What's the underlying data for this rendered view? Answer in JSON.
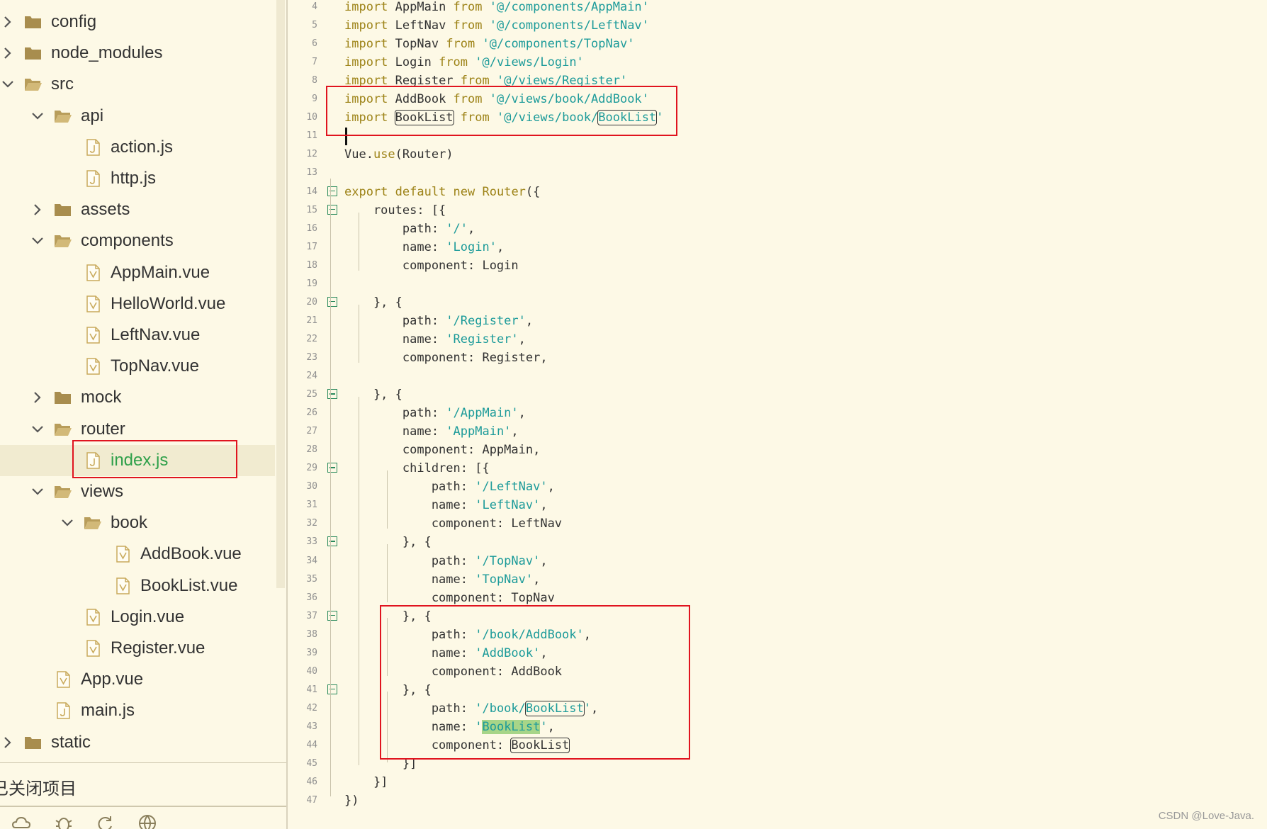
{
  "sidebar": {
    "items": [
      {
        "label": "config",
        "kind": "folder",
        "expanded": false,
        "depth": 0
      },
      {
        "label": "node_modules",
        "kind": "folder",
        "expanded": false,
        "depth": 0
      },
      {
        "label": "src",
        "kind": "folder",
        "expanded": true,
        "depth": 0
      },
      {
        "label": "api",
        "kind": "folder",
        "expanded": true,
        "depth": 1
      },
      {
        "label": "action.js",
        "kind": "js",
        "depth": 2
      },
      {
        "label": "http.js",
        "kind": "js",
        "depth": 2
      },
      {
        "label": "assets",
        "kind": "folder",
        "expanded": false,
        "depth": 1
      },
      {
        "label": "components",
        "kind": "folder",
        "expanded": true,
        "depth": 1
      },
      {
        "label": "AppMain.vue",
        "kind": "vue",
        "depth": 2
      },
      {
        "label": "HelloWorld.vue",
        "kind": "vue",
        "depth": 2
      },
      {
        "label": "LeftNav.vue",
        "kind": "vue",
        "depth": 2
      },
      {
        "label": "TopNav.vue",
        "kind": "vue",
        "depth": 2
      },
      {
        "label": "mock",
        "kind": "folder",
        "expanded": false,
        "depth": 1
      },
      {
        "label": "router",
        "kind": "folder",
        "expanded": true,
        "depth": 1
      },
      {
        "label": "index.js",
        "kind": "js",
        "depth": 2,
        "selected": true
      },
      {
        "label": "views",
        "kind": "folder",
        "expanded": true,
        "depth": 1
      },
      {
        "label": "book",
        "kind": "folder",
        "expanded": true,
        "depth": 2
      },
      {
        "label": "AddBook.vue",
        "kind": "vue",
        "depth": 3
      },
      {
        "label": "BookList.vue",
        "kind": "vue",
        "depth": 3
      },
      {
        "label": "Login.vue",
        "kind": "vue",
        "depth": 2
      },
      {
        "label": "Register.vue",
        "kind": "vue",
        "depth": 2
      },
      {
        "label": "App.vue",
        "kind": "vue",
        "depth": 1
      },
      {
        "label": "main.js",
        "kind": "js",
        "depth": 1
      },
      {
        "label": "static",
        "kind": "folder",
        "expanded": false,
        "depth": 0
      }
    ],
    "closed_projects_label": "已关闭项目",
    "bottom_icons": [
      "cloud-icon",
      "bug-icon",
      "refresh-icon",
      "globe-icon"
    ]
  },
  "editor": {
    "lines": [
      {
        "num": "4",
        "tokens": [
          [
            "import ",
            "kw"
          ],
          [
            "AppMain ",
            ""
          ],
          [
            "from ",
            "kw"
          ],
          [
            "'@/components/AppMain'",
            "str"
          ]
        ]
      },
      {
        "num": "5",
        "tokens": [
          [
            "import ",
            "kw"
          ],
          [
            "LeftNav ",
            ""
          ],
          [
            "from ",
            "kw"
          ],
          [
            "'@/components/LeftNav'",
            "str"
          ]
        ]
      },
      {
        "num": "6",
        "tokens": [
          [
            "import ",
            "kw"
          ],
          [
            "TopNav ",
            ""
          ],
          [
            "from ",
            "kw"
          ],
          [
            "'@/components/TopNav'",
            "str"
          ]
        ]
      },
      {
        "num": "7",
        "tokens": [
          [
            "import ",
            "kw"
          ],
          [
            "Login ",
            ""
          ],
          [
            "from ",
            "kw"
          ],
          [
            "'@/views/Login'",
            "str"
          ]
        ]
      },
      {
        "num": "8",
        "tokens": [
          [
            "import ",
            "kw"
          ],
          [
            "Register ",
            ""
          ],
          [
            "from ",
            "kw"
          ],
          [
            "'@/views/Register'",
            "str"
          ]
        ]
      },
      {
        "num": "9",
        "tokens": [
          [
            "import ",
            "kw"
          ],
          [
            "AddBook ",
            ""
          ],
          [
            "from ",
            "kw"
          ],
          [
            "'@/views/book/AddBook'",
            "str"
          ]
        ]
      },
      {
        "num": "10",
        "tokens": [
          [
            "import ",
            "kw"
          ],
          [
            "BookList",
            "boxed"
          ],
          [
            " ",
            ""
          ],
          [
            "from ",
            "kw"
          ],
          [
            "'@/views/book/",
            "str"
          ],
          [
            "BookList",
            "str boxed"
          ],
          [
            "'",
            "str"
          ]
        ]
      },
      {
        "num": "11",
        "tokens": []
      },
      {
        "num": "12",
        "tokens": [
          [
            "Vue.",
            ""
          ],
          [
            "use",
            "fn"
          ],
          [
            "(Router)",
            ""
          ]
        ]
      },
      {
        "num": "13",
        "tokens": []
      },
      {
        "num": "14",
        "fold": true,
        "tokens": [
          [
            "export ",
            "kw"
          ],
          [
            "default ",
            "kw"
          ],
          [
            "new ",
            "kw"
          ],
          [
            "Router",
            "fn"
          ],
          [
            "({",
            ""
          ]
        ]
      },
      {
        "num": "15",
        "fold": true,
        "tokens": [
          [
            "    routes: [{",
            ""
          ]
        ]
      },
      {
        "num": "16",
        "tokens": [
          [
            "        path: ",
            ""
          ],
          [
            "'/'",
            "str"
          ],
          [
            ",",
            ""
          ]
        ]
      },
      {
        "num": "17",
        "tokens": [
          [
            "        name: ",
            ""
          ],
          [
            "'Login'",
            "str"
          ],
          [
            ",",
            ""
          ]
        ]
      },
      {
        "num": "18",
        "tokens": [
          [
            "        component: Login",
            ""
          ]
        ]
      },
      {
        "num": "19",
        "tokens": []
      },
      {
        "num": "20",
        "fold": true,
        "tokens": [
          [
            "    }, {",
            ""
          ]
        ]
      },
      {
        "num": "21",
        "tokens": [
          [
            "        path: ",
            ""
          ],
          [
            "'/Register'",
            "str"
          ],
          [
            ",",
            ""
          ]
        ]
      },
      {
        "num": "22",
        "tokens": [
          [
            "        name: ",
            ""
          ],
          [
            "'Register'",
            "str"
          ],
          [
            ",",
            ""
          ]
        ]
      },
      {
        "num": "23",
        "tokens": [
          [
            "        component: Register,",
            ""
          ]
        ]
      },
      {
        "num": "24",
        "tokens": []
      },
      {
        "num": "25",
        "fold": true,
        "tokens": [
          [
            "    }, {",
            ""
          ]
        ]
      },
      {
        "num": "26",
        "tokens": [
          [
            "        path: ",
            ""
          ],
          [
            "'/AppMain'",
            "str"
          ],
          [
            ",",
            ""
          ]
        ]
      },
      {
        "num": "27",
        "tokens": [
          [
            "        name: ",
            ""
          ],
          [
            "'AppMain'",
            "str"
          ],
          [
            ",",
            ""
          ]
        ]
      },
      {
        "num": "28",
        "tokens": [
          [
            "        component: AppMain,",
            ""
          ]
        ]
      },
      {
        "num": "29",
        "fold": true,
        "tokens": [
          [
            "        children: [{",
            ""
          ]
        ]
      },
      {
        "num": "30",
        "tokens": [
          [
            "            path: ",
            ""
          ],
          [
            "'/LeftNav'",
            "str"
          ],
          [
            ",",
            ""
          ]
        ]
      },
      {
        "num": "31",
        "tokens": [
          [
            "            name: ",
            ""
          ],
          [
            "'LeftNav'",
            "str"
          ],
          [
            ",",
            ""
          ]
        ]
      },
      {
        "num": "32",
        "tokens": [
          [
            "            component: LeftNav",
            ""
          ]
        ]
      },
      {
        "num": "33",
        "fold": true,
        "tokens": [
          [
            "        }, {",
            ""
          ]
        ]
      },
      {
        "num": "34",
        "tokens": [
          [
            "            path: ",
            ""
          ],
          [
            "'/TopNav'",
            "str"
          ],
          [
            ",",
            ""
          ]
        ]
      },
      {
        "num": "35",
        "tokens": [
          [
            "            name: ",
            ""
          ],
          [
            "'TopNav'",
            "str"
          ],
          [
            ",",
            ""
          ]
        ]
      },
      {
        "num": "36",
        "tokens": [
          [
            "            component: TopNav",
            ""
          ]
        ]
      },
      {
        "num": "37",
        "fold": true,
        "tokens": [
          [
            "        }, {",
            ""
          ]
        ]
      },
      {
        "num": "38",
        "tokens": [
          [
            "            path: ",
            ""
          ],
          [
            "'/book/AddBook'",
            "str"
          ],
          [
            ",",
            ""
          ]
        ]
      },
      {
        "num": "39",
        "tokens": [
          [
            "            name: ",
            ""
          ],
          [
            "'AddBook'",
            "str"
          ],
          [
            ",",
            ""
          ]
        ]
      },
      {
        "num": "40",
        "tokens": [
          [
            "            component: AddBook",
            ""
          ]
        ]
      },
      {
        "num": "41",
        "fold": true,
        "tokens": [
          [
            "        }, {",
            ""
          ]
        ]
      },
      {
        "num": "42",
        "tokens": [
          [
            "            path: ",
            ""
          ],
          [
            "'/book/",
            "str"
          ],
          [
            "BookList",
            "str boxed"
          ],
          [
            "'",
            "str"
          ],
          [
            ",",
            ""
          ]
        ]
      },
      {
        "num": "43",
        "tokens": [
          [
            "            name: ",
            ""
          ],
          [
            "'",
            "str"
          ],
          [
            "BookList",
            "str hl"
          ],
          [
            "'",
            "str"
          ],
          [
            ",",
            ""
          ]
        ]
      },
      {
        "num": "44",
        "tokens": [
          [
            "            component: ",
            ""
          ],
          [
            "BookList",
            "boxed"
          ]
        ]
      },
      {
        "num": "45",
        "tokens": [
          [
            "        }]",
            ""
          ]
        ]
      },
      {
        "num": "46",
        "tokens": [
          [
            "    }]",
            ""
          ]
        ]
      },
      {
        "num": "47",
        "tokens": [
          [
            "})",
            ""
          ]
        ]
      }
    ]
  },
  "watermark": "CSDN @Love-Java.",
  "colors": {
    "background": "#fdf9e6",
    "keyword": "#9e8419",
    "string": "#1d9b9a",
    "annotation": "#e0141f",
    "active_file": "#2fa04a"
  }
}
